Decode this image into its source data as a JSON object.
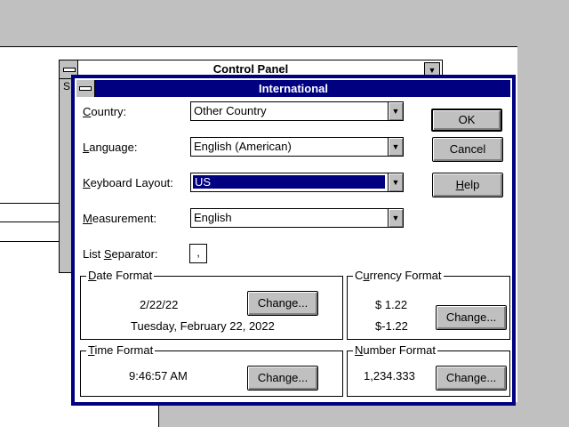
{
  "background_window": {
    "title": "Control Panel",
    "menu_initial": "S"
  },
  "dialog": {
    "title": "International",
    "fields": {
      "country": {
        "label_pre": "",
        "label_ul": "C",
        "label_post": "ountry:",
        "value": "Other Country"
      },
      "language": {
        "label_pre": "",
        "label_ul": "L",
        "label_post": "anguage:",
        "value": "English (American)"
      },
      "keyboard": {
        "label_pre": "",
        "label_ul": "K",
        "label_post": "eyboard Layout:",
        "value": "US"
      },
      "measurement": {
        "label_pre": "",
        "label_ul": "M",
        "label_post": "easurement:",
        "value": "English"
      },
      "list_separator": {
        "label_pre": "List ",
        "label_ul": "S",
        "label_post": "eparator:",
        "value": ","
      }
    },
    "buttons": {
      "ok": "OK",
      "cancel": "Cancel",
      "help_ul": "H",
      "help_rest": "elp"
    },
    "date_format": {
      "title_ul": "D",
      "title_rest": "ate Format",
      "short": "2/22/22",
      "long": "Tuesday, February 22, 2022",
      "change": "Change..."
    },
    "currency_format": {
      "title_pre": "C",
      "title_ul": "u",
      "title_rest": "rrency Format",
      "positive": "$ 1.22",
      "negative": "$-1.22",
      "change": "Change..."
    },
    "time_format": {
      "title_ul": "T",
      "title_rest": "ime Format",
      "value": "9:46:57 AM",
      "change": "Change..."
    },
    "number_format": {
      "title_ul": "N",
      "title_rest": "umber Format",
      "value": "1,234.333",
      "change": "Change..."
    }
  }
}
